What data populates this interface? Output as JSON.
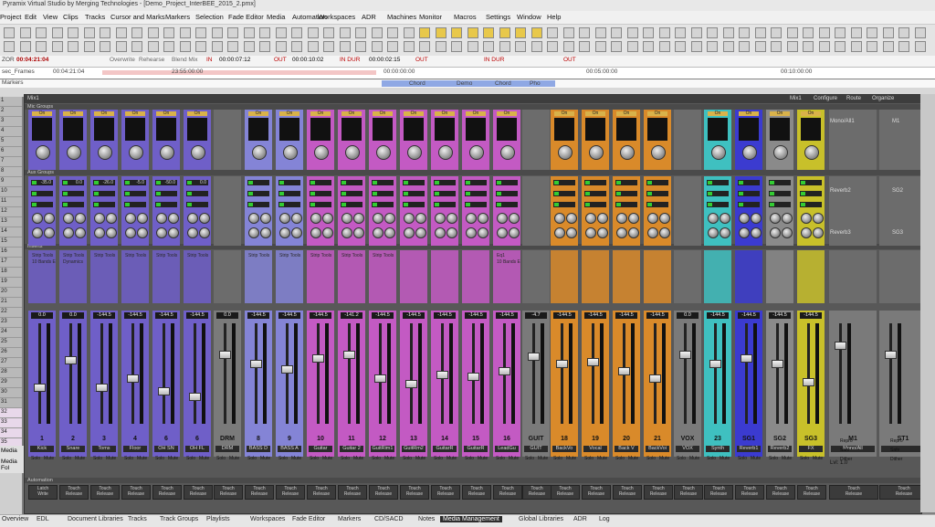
{
  "app": {
    "title": "Pyramix Virtual Studio by Merging Technologies - [Demo_Project_InterBEE_2015_2.pmx]"
  },
  "menu": [
    "Project",
    "Edit",
    "View",
    "Clips",
    "Tracks",
    "Cursor and Marks",
    "Markers",
    "Selection",
    "Fade Editor",
    "Media",
    "Automation",
    "Workspaces",
    "ADR",
    "Machines",
    "Monitor",
    "Macros",
    "Settings",
    "Window",
    "Help"
  ],
  "transport": {
    "timecode": "00:04:21:04",
    "items": [
      "Overwrite",
      "Rehearse",
      "Blend Mix",
      "IN",
      "00:00:07:12",
      "OUT",
      "00:00:10:02",
      "IN DUR",
      "00:00:02:15",
      "OUT",
      "IN DUR",
      "OUT"
    ]
  },
  "ruler": {
    "left_label": "sec_Frames",
    "time": "00:04:21:04",
    "ticks": [
      "23:55:00:00",
      "00:00:00:00",
      "00:05:00:00",
      "00:10:00:00"
    ],
    "markers_label": "Markers",
    "clip_labels": [
      "Chord",
      "Demo",
      "Chord",
      "Pho"
    ]
  },
  "tracklist": [
    "1",
    "2",
    "3",
    "4",
    "5",
    "6",
    "7",
    "8",
    "9",
    "10",
    "11",
    "12",
    "13",
    "14",
    "15",
    "16",
    "17",
    "18",
    "19",
    "20",
    "21",
    "22",
    "23",
    "24",
    "25",
    "26",
    "27",
    "28",
    "29",
    "30",
    "31",
    "32",
    "33",
    "34",
    "35"
  ],
  "leftpane": {
    "media": "Media",
    "media_folders": "Media Fol"
  },
  "mixer": {
    "title": "Mix1",
    "title_right": [
      "Mix1",
      "Configure",
      "Route",
      "Organize"
    ],
    "section_labels": {
      "sends": "Mic Groups",
      "aux": "Aux Groups",
      "inserts": "Inserts",
      "automation": "Automation"
    },
    "aux_values": [
      "-35.0",
      "0.0",
      "-26.0",
      "-5.0",
      "-50.0",
      "0.0"
    ],
    "busses": {
      "right_a": "Mono/All1",
      "right_a_tag": "M1",
      "right_b": "Reverb2",
      "right_b_tag": "SG2",
      "right_c": "Reverb3",
      "right_c_tag": "SG3"
    },
    "insert_labels": {
      "strip_tools": "Strip Tools",
      "dynamics": "Dynamics",
      "ten_bands": "10 Bands E",
      "eq": "Eq1"
    },
    "channels": [
      {
        "num": "1",
        "name": "Kick",
        "level": "0.0",
        "color": "#6f5fc8"
      },
      {
        "num": "2",
        "name": "Snare",
        "level": "0.0",
        "color": "#6f5fc8"
      },
      {
        "num": "3",
        "name": "Toms",
        "level": "-144.5",
        "color": "#6f5fc8"
      },
      {
        "num": "4",
        "name": "Floor",
        "level": "-144.5",
        "color": "#6f5fc8"
      },
      {
        "num": "6",
        "name": "OH SN",
        "level": "-144.5",
        "color": "#6f5fc8"
      },
      {
        "num": "6",
        "name": "OH FL",
        "level": "-144.5",
        "color": "#6f5fc8"
      },
      {
        "num": "DRM",
        "name": "DRM",
        "level": "0.0",
        "color": "#777777"
      },
      {
        "num": "8",
        "name": "BASS D",
        "level": "-144.5",
        "color": "#8484d6"
      },
      {
        "num": "9",
        "name": "BASS A",
        "level": "-144.5",
        "color": "#8484d6"
      },
      {
        "num": "10",
        "name": "Guitar",
        "level": "-144.5",
        "color": "#c35ac3"
      },
      {
        "num": "11",
        "name": "Guitar 2",
        "level": "-141.2",
        "color": "#c35ac3"
      },
      {
        "num": "12",
        "name": "GuitRim1",
        "level": "-144.5",
        "color": "#c35ac3"
      },
      {
        "num": "13",
        "name": "GuitRm2",
        "level": "-144.5",
        "color": "#c35ac3"
      },
      {
        "num": "14",
        "name": "GuitarR",
        "level": "-144.5",
        "color": "#c35ac3"
      },
      {
        "num": "15",
        "name": "GuitarR",
        "level": "-144.5",
        "color": "#c35ac3"
      },
      {
        "num": "16",
        "name": "LeadGu",
        "level": "-144.5",
        "color": "#c35ac3"
      },
      {
        "num": "GUIT",
        "name": "GUIT",
        "level": "-4.7",
        "color": "#777777"
      },
      {
        "num": "18",
        "name": "BackVo",
        "level": "-144.5",
        "color": "#d98a2a"
      },
      {
        "num": "19",
        "name": "Vocal",
        "level": "-144.5",
        "color": "#d98a2a"
      },
      {
        "num": "20",
        "name": "Back V",
        "level": "-144.5",
        "color": "#d98a2a"
      },
      {
        "num": "21",
        "name": "BackVoi",
        "level": "-144.5",
        "color": "#d98a2a"
      },
      {
        "num": "VOX",
        "name": "VOX",
        "level": "0.0",
        "color": "#777777"
      },
      {
        "num": "23",
        "name": "Synth",
        "level": "-144.5",
        "color": "#3fc0c0"
      },
      {
        "num": "SG1",
        "name": "Reverb1",
        "level": "-144.5",
        "color": "#3b3bd0"
      },
      {
        "num": "SG2",
        "name": "Reverb2",
        "level": "-144.5",
        "color": "#8a8a8a"
      },
      {
        "num": "SG3",
        "name": "FX",
        "level": "-144.5",
        "color": "#c8c02a"
      },
      {
        "num": "M1",
        "name": "Mono/All",
        "level": "",
        "color": "#6a6a6a"
      },
      {
        "num": "ST1",
        "name": "",
        "level": "",
        "color": "#6a6a6a"
      }
    ],
    "master": {
      "lvl": "Lvl: 1.0",
      "options": [
        "Repro",
        "Safe",
        "Dither"
      ]
    },
    "strip_buttons": {
      "solo": "Solo",
      "mute": "Mute",
      "on": "On",
      "off": "Off"
    },
    "automation_buttons": {
      "top": "Latch",
      "bottom": "Write",
      "alt_top": "Touch",
      "alt_bottom": "Release"
    }
  },
  "taskbar": [
    "Overview",
    "EDL",
    "Document Libraries",
    "Tracks",
    "Track Groups",
    "Playlists",
    "Workspaces",
    "Fade Editor",
    "Markers",
    "CD/SACD",
    "Notes",
    "Media Management",
    "Global Libraries",
    "ADR",
    "Log"
  ],
  "taskbar_active": "Media Management"
}
